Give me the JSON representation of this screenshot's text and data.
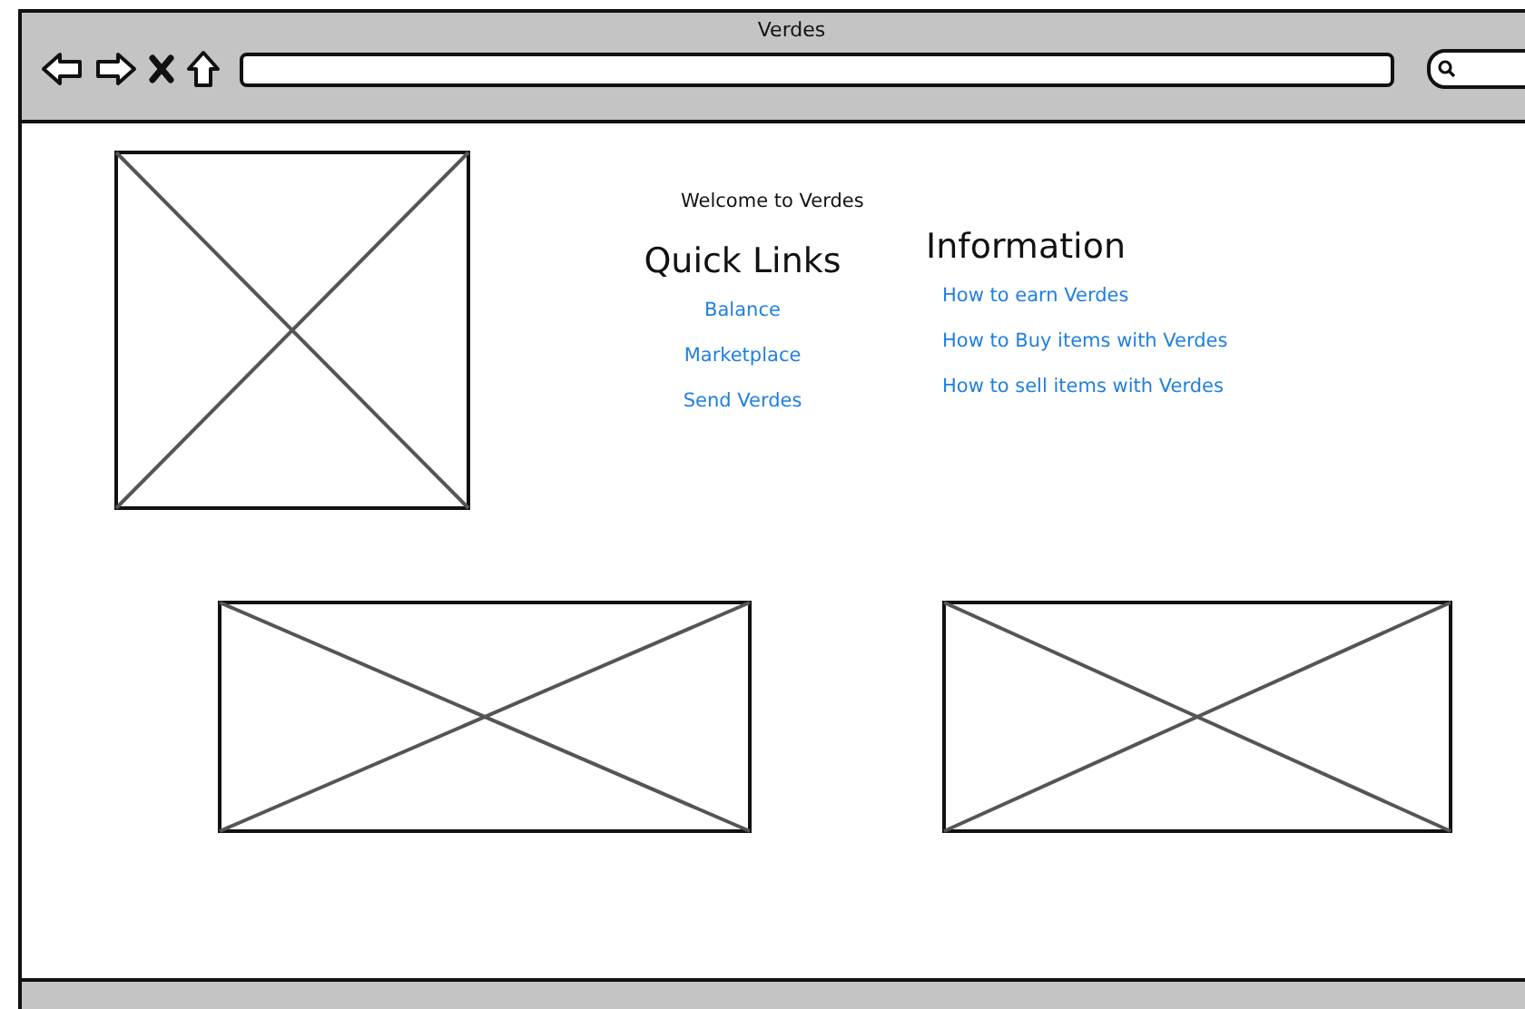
{
  "window": {
    "title": "Verdes"
  },
  "welcome": "Welcome to Verdes",
  "quick_links": {
    "heading": "Quick Links",
    "links": [
      "Balance",
      "Marketplace",
      "Send Verdes"
    ]
  },
  "information": {
    "heading": "Information",
    "links": [
      "How to earn Verdes",
      "How to Buy items with Verdes",
      "How to sell items with Verdes"
    ]
  }
}
